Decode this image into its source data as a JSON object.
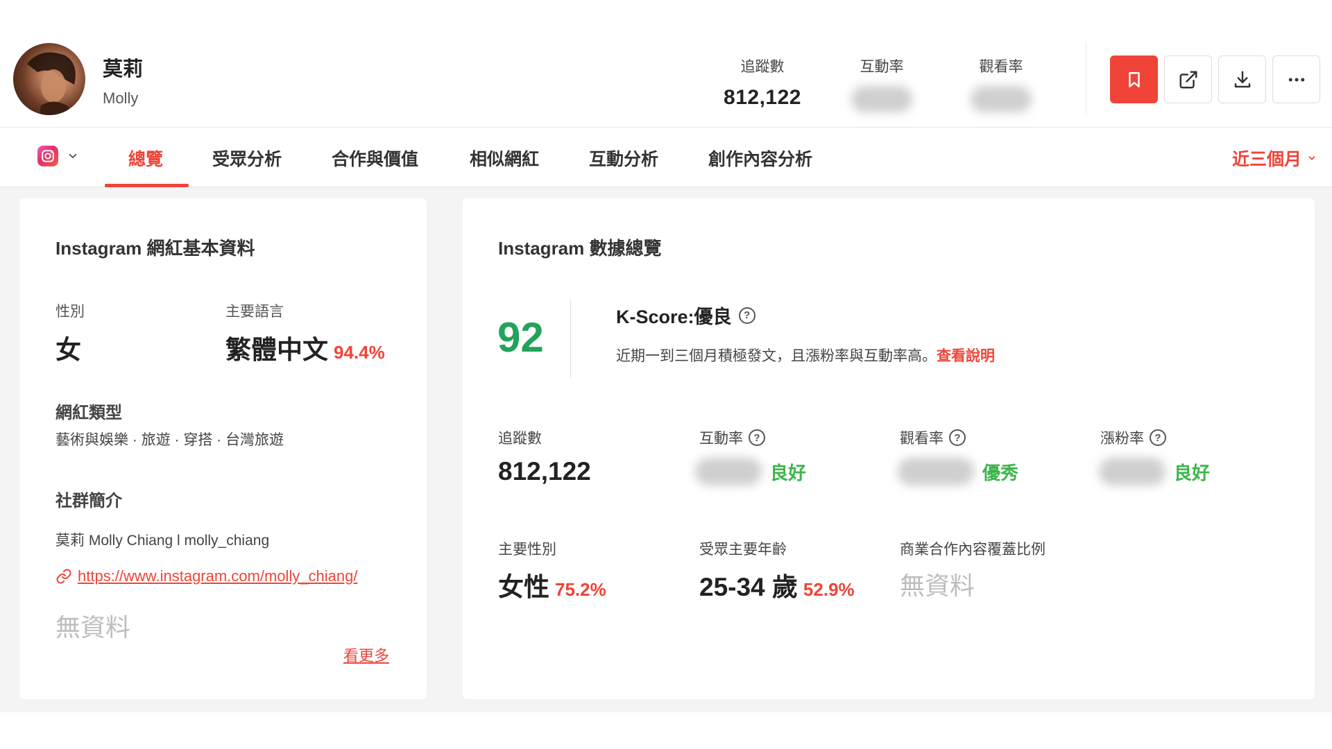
{
  "profile": {
    "name_zh": "莫莉",
    "name_en": "Molly"
  },
  "header_stats": [
    {
      "label": "追蹤數",
      "value": "812,122"
    },
    {
      "label": "互動率",
      "value": ""
    },
    {
      "label": "觀看率",
      "value": ""
    }
  ],
  "actions": {
    "bookmark": "bookmark-icon",
    "external": "external-link-icon",
    "download": "download-icon",
    "more": "more-icon"
  },
  "colors": {
    "accent": "#f04438",
    "score_green": "#22a35a",
    "grade_green": "#3bb64a"
  },
  "tabs": [
    {
      "label": "總覽",
      "active": true
    },
    {
      "label": "受眾分析"
    },
    {
      "label": "合作與價值"
    },
    {
      "label": "相似網紅"
    },
    {
      "label": "互動分析"
    },
    {
      "label": "創作內容分析"
    }
  ],
  "period": "近三個月",
  "left_card": {
    "title": "Instagram 網紅基本資料",
    "gender_label": "性別",
    "gender_value": "女",
    "language_label": "主要語言",
    "language_value": "繁體中文",
    "language_pct": "94.4%",
    "type_title": "網紅類型",
    "type_value": "藝術與娛樂 · 旅遊 · 穿搭 · 台灣旅遊",
    "bio_title": "社群簡介",
    "bio_text": "莫莉 Molly Chiang l molly_chiang",
    "bio_link": "https://www.instagram.com/molly_chiang/",
    "no_data": "無資料",
    "see_more": "看更多"
  },
  "right_card": {
    "title": "Instagram 數據總覽",
    "kscore": "92",
    "kscore_title": "K-Score:優良",
    "kscore_desc": "近期一到三個月積極發文，且漲粉率與互動率高。",
    "kscore_link": "查看說明",
    "metrics": {
      "followers_label": "追蹤數",
      "followers_value": "812,122",
      "engagement_label": "互動率",
      "engagement_grade": "良好",
      "view_label": "觀看率",
      "view_grade": "優秀",
      "growth_label": "漲粉率",
      "growth_grade": "良好"
    },
    "audience": {
      "gender_label": "主要性別",
      "gender_value": "女性",
      "gender_pct": "75.2%",
      "age_label": "受眾主要年齡",
      "age_value": "25-34 歲",
      "age_pct": "52.9%",
      "coverage_label": "商業合作內容覆蓋比例",
      "coverage_value": "無資料"
    }
  }
}
